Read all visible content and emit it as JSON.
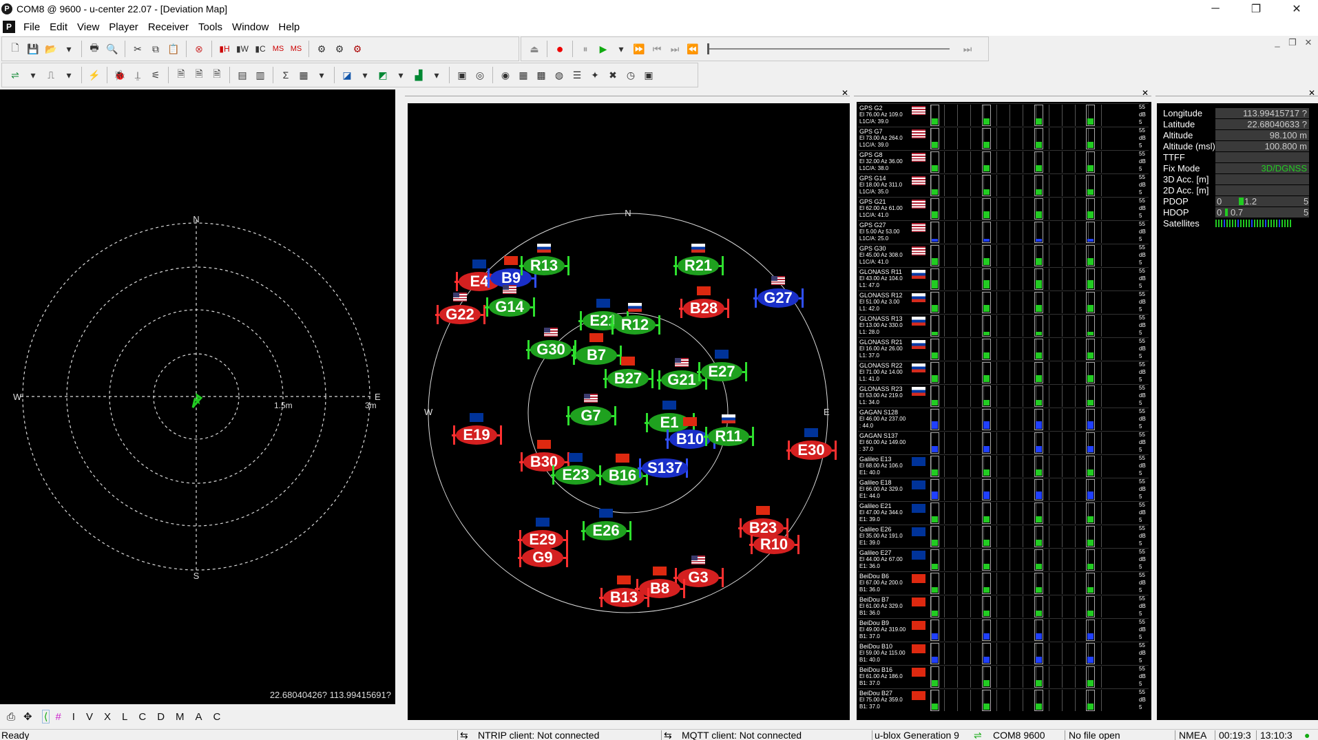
{
  "window": {
    "title": "COM8 @ 9600 - u-center 22.07 - [Deviation Map]",
    "app_icon": "u-center-icon",
    "min": "─",
    "max": "❐",
    "close": "✕"
  },
  "menu": {
    "items": [
      "File",
      "Edit",
      "View",
      "Player",
      "Receiver",
      "Tools",
      "Window",
      "Help"
    ],
    "doc_icon": "P"
  },
  "mdi": {
    "min": "_",
    "restore": "❐",
    "close": "✕"
  },
  "toolbar1": {
    "buttons": [
      "new-icon",
      "save-icon",
      "open-icon",
      "dropdown-icon",
      "print-icon",
      "print-preview-icon",
      "cut-icon",
      "copy-icon",
      "paste-icon",
      "stop-icon",
      "bar-h-icon",
      "bar-w-icon",
      "bar-c-icon",
      "ms-icon",
      "ms2-icon",
      "gear-icon",
      "gear2-icon",
      "gear3-icon"
    ]
  },
  "player": {
    "eject": "⏏",
    "record": "●",
    "pause": "⏸",
    "play": "▶",
    "dropdown": "▾",
    "fastforward": "⏩",
    "prev": "⏮",
    "next": "⏭",
    "first": "⏪",
    "last": "⏭"
  },
  "deviation": {
    "coord": "22.68040426? 113.99415691?",
    "n": "N",
    "s": "S",
    "w": "W",
    "e": "E",
    "r1": "1.5m",
    "r2": "3m"
  },
  "skyview": {
    "n": "N",
    "e": "E",
    "w": "W"
  },
  "sats": [
    {
      "id": "E4",
      "c": "red",
      "flag": "eu"
    },
    {
      "id": "B9",
      "c": "blue",
      "flag": "cn"
    },
    {
      "id": "R13",
      "c": "green",
      "flag": "ru"
    },
    {
      "id": "R21",
      "c": "green",
      "flag": "ru"
    },
    {
      "id": "G22",
      "c": "red",
      "flag": "us"
    },
    {
      "id": "G14",
      "c": "green",
      "flag": "us"
    },
    {
      "id": "B28",
      "c": "red",
      "flag": "cn"
    },
    {
      "id": "G27",
      "c": "blue",
      "flag": "us"
    },
    {
      "id": "E21",
      "c": "green",
      "flag": "eu"
    },
    {
      "id": "R12",
      "c": "green",
      "flag": "ru"
    },
    {
      "id": "G30",
      "c": "green",
      "flag": "us"
    },
    {
      "id": "B7",
      "c": "green",
      "flag": "cn"
    },
    {
      "id": "B27",
      "c": "green",
      "flag": "cn"
    },
    {
      "id": "G21",
      "c": "green",
      "flag": "us"
    },
    {
      "id": "E27",
      "c": "green",
      "flag": "eu"
    },
    {
      "id": "G7",
      "c": "green",
      "flag": "us"
    },
    {
      "id": "E1",
      "c": "green",
      "flag": "eu"
    },
    {
      "id": "B10",
      "c": "blue",
      "flag": "cn"
    },
    {
      "id": "R11",
      "c": "green",
      "flag": "ru"
    },
    {
      "id": "E19",
      "c": "red",
      "flag": "eu"
    },
    {
      "id": "E30",
      "c": "red",
      "flag": "eu"
    },
    {
      "id": "B30",
      "c": "red",
      "flag": "cn"
    },
    {
      "id": "E23",
      "c": "green",
      "flag": "eu"
    },
    {
      "id": "B16",
      "c": "green",
      "flag": "cn"
    },
    {
      "id": "S137",
      "c": "blue",
      "flag": ""
    },
    {
      "id": "E29",
      "c": "red",
      "flag": "eu"
    },
    {
      "id": "G9",
      "c": "red",
      "flag": ""
    },
    {
      "id": "E26",
      "c": "green",
      "flag": "eu"
    },
    {
      "id": "B23",
      "c": "red",
      "flag": "cn"
    },
    {
      "id": "R10",
      "c": "red",
      "flag": ""
    },
    {
      "id": "G3",
      "c": "red",
      "flag": "us"
    },
    {
      "id": "B8",
      "c": "red",
      "flag": "cn"
    },
    {
      "id": "B13",
      "c": "red",
      "flag": "cn"
    }
  ],
  "signals": [
    {
      "l1": "GPS G2",
      "l2": "El 76.00 Az 109.0",
      "l3": "L1C/A: 39.0",
      "flag": "us",
      "bars": [
        21,
        21,
        21,
        21
      ],
      "col": "green"
    },
    {
      "l1": "GPS G7",
      "l2": "El 73.00 Az 264.0",
      "l3": "L1C/A: 39.0",
      "flag": "us",
      "bars": [
        21,
        21,
        21,
        21
      ],
      "col": "green"
    },
    {
      "l1": "GPS G8",
      "l2": "El 32.00 Az 36.00",
      "l3": "L1C/A: 38.0",
      "flag": "us",
      "bars": [
        20,
        20,
        20,
        20
      ],
      "col": "green"
    },
    {
      "l1": "GPS G14",
      "l2": "El 18.00 Az 311.0",
      "l3": "L1C/A: 35.0",
      "flag": "us",
      "bars": [
        19,
        19,
        19,
        19
      ],
      "col": "green"
    },
    {
      "l1": "GPS G21",
      "l2": "El 62.00 Az 61.00",
      "l3": "L1C/A: 41.0",
      "flag": "us",
      "bars": [
        22,
        22,
        22,
        22
      ],
      "col": "green"
    },
    {
      "l1": "GPS G27",
      "l2": "El 5.00 Az 53.00",
      "l3": "L1C/A: 25.0",
      "flag": "us",
      "bars": [
        12,
        12,
        12,
        12
      ],
      "col": "blue"
    },
    {
      "l1": "GPS G30",
      "l2": "El 45.00 Az 308.0",
      "l3": "L1C/A: 41.0",
      "flag": "us",
      "bars": [
        22,
        22,
        22,
        22
      ],
      "col": "green"
    },
    {
      "l1": "GLONASS R11",
      "l2": "El 43.00 Az 104.0",
      "l3": "L1: 47.0",
      "flag": "ru",
      "bars": [
        25,
        25,
        25,
        25
      ],
      "col": "green"
    },
    {
      "l1": "GLONASS R12",
      "l2": "El 51.00 Az 3.00",
      "l3": "L1: 42.0",
      "flag": "ru",
      "bars": [
        22,
        22,
        22,
        22
      ],
      "col": "green"
    },
    {
      "l1": "GLONASS R13",
      "l2": "El 13.00 Az 330.0",
      "l3": "L1: 28.0",
      "flag": "ru",
      "bars": [
        14,
        14,
        14,
        14
      ],
      "col": "green"
    },
    {
      "l1": "GLONASS R21",
      "l2": "El 16.00 Az 26.00",
      "l3": "L1: 37.0",
      "flag": "ru",
      "bars": [
        20,
        20,
        20,
        20
      ],
      "col": "green"
    },
    {
      "l1": "GLONASS R22",
      "l2": "El 71.00 Az 14.00",
      "l3": "L1: 41.0",
      "flag": "ru",
      "bars": [
        22,
        22,
        22,
        22
      ],
      "col": "green"
    },
    {
      "l1": "GLONASS R23",
      "l2": "El 53.00 Az 219.0",
      "l3": "L1: 34.0",
      "flag": "ru",
      "bars": [
        18,
        18,
        18,
        18
      ],
      "col": "green"
    },
    {
      "l1": "GAGAN S128",
      "l2": "El 46.00 Az 237.00",
      "l3": ": 44.0",
      "flag": "",
      "bars": [
        24,
        24,
        24,
        24
      ],
      "col": "blue"
    },
    {
      "l1": "GAGAN S137",
      "l2": "El 60.00 Az 149.00",
      "l3": ": 37.0",
      "flag": "",
      "bars": [
        20,
        20,
        20,
        20
      ],
      "col": "blue"
    },
    {
      "l1": "Galileo E13",
      "l2": "El 68.00 Az 106.0",
      "l3": "E1: 40.0",
      "flag": "eu",
      "bars": [
        21,
        21,
        21,
        21
      ],
      "col": "green"
    },
    {
      "l1": "Galileo E18",
      "l2": "El 66.00 Az 329.0",
      "l3": "E1: 44.0",
      "flag": "eu",
      "bars": [
        24,
        24,
        24,
        24
      ],
      "col": "blue"
    },
    {
      "l1": "Galileo E21",
      "l2": "El 47.00 Az 344.0",
      "l3": "E1: 39.0",
      "flag": "eu",
      "bars": [
        21,
        21,
        21,
        21
      ],
      "col": "green"
    },
    {
      "l1": "Galileo E26",
      "l2": "El 35.00 Az 191.0",
      "l3": "E1: 39.0",
      "flag": "eu",
      "bars": [
        21,
        21,
        21,
        21
      ],
      "col": "green"
    },
    {
      "l1": "Galileo E27",
      "l2": "El 44.00 Az 67.00",
      "l3": "E1: 36.0",
      "flag": "eu",
      "bars": [
        19,
        19,
        19,
        19
      ],
      "col": "green"
    },
    {
      "l1": "BeiDou B6",
      "l2": "El 67.00 Az 200.0",
      "l3": "B1: 36.0",
      "flag": "cn",
      "bars": [
        19,
        19,
        19,
        19
      ],
      "col": "green"
    },
    {
      "l1": "BeiDou B7",
      "l2": "El 61.00 Az 329.0",
      "l3": "B1: 36.0",
      "flag": "cn",
      "bars": [
        19,
        19,
        19,
        19
      ],
      "col": "green"
    },
    {
      "l1": "BeiDou B9",
      "l2": "El 49.00 Az 319.00",
      "l3": "B1: 37.0",
      "flag": "cn",
      "bars": [
        20,
        20,
        20,
        20
      ],
      "col": "blue"
    },
    {
      "l1": "BeiDou B10",
      "l2": "El 59.00 Az 115.00",
      "l3": "B1: 40.0",
      "flag": "cn",
      "bars": [
        21,
        21,
        21,
        21
      ],
      "col": "blue"
    },
    {
      "l1": "BeiDou B16",
      "l2": "El 61.00 Az 186.0",
      "l3": "B1: 37.0",
      "flag": "cn",
      "bars": [
        20,
        20,
        20,
        20
      ],
      "col": "green"
    },
    {
      "l1": "BeiDou B27",
      "l2": "El 75.00 Az 359.0",
      "l3": "B1: 37.0",
      "flag": "cn",
      "bars": [
        20,
        20,
        20,
        20
      ],
      "col": "green"
    }
  ],
  "scale": {
    "top": "55",
    "mid": "dB",
    "bot": "5"
  },
  "info": [
    {
      "k": "Longitude",
      "v": "113.99415717 ?"
    },
    {
      "k": "Latitude",
      "v": "22.68040633 ?"
    },
    {
      "k": "Altitude",
      "v": "98.100 m"
    },
    {
      "k": "Altitude (msl)",
      "v": "100.800 m"
    },
    {
      "k": "TTFF",
      "v": ""
    },
    {
      "k": "Fix Mode",
      "v": "3D/DGNSS"
    },
    {
      "k": "3D Acc. [m]",
      "v": ""
    },
    {
      "k": "2D Acc. [m]",
      "v": ""
    }
  ],
  "pdop": {
    "k": "PDOP",
    "min": "0",
    "val": "1.2",
    "max": "5",
    "frac": 0.24
  },
  "hdop": {
    "k": "HDOP",
    "min": "0",
    "val": "0.7",
    "max": "5",
    "frac": 0.14
  },
  "satellites": {
    "k": "Satellites"
  },
  "lefttools": {
    "letters": [
      "I",
      "V",
      "X",
      "L",
      "C",
      "D",
      "M",
      "A",
      "C"
    ]
  },
  "status": {
    "ready": "Ready",
    "ntrip": "NTRIP client: Not connected",
    "mqtt": "MQTT client: Not connected",
    "gen": "u-blox Generation 9",
    "port": "COM8 9600",
    "file": "No file open",
    "proto": "NMEA",
    "t1": "00:19:3",
    "t2": "13:10:3"
  }
}
